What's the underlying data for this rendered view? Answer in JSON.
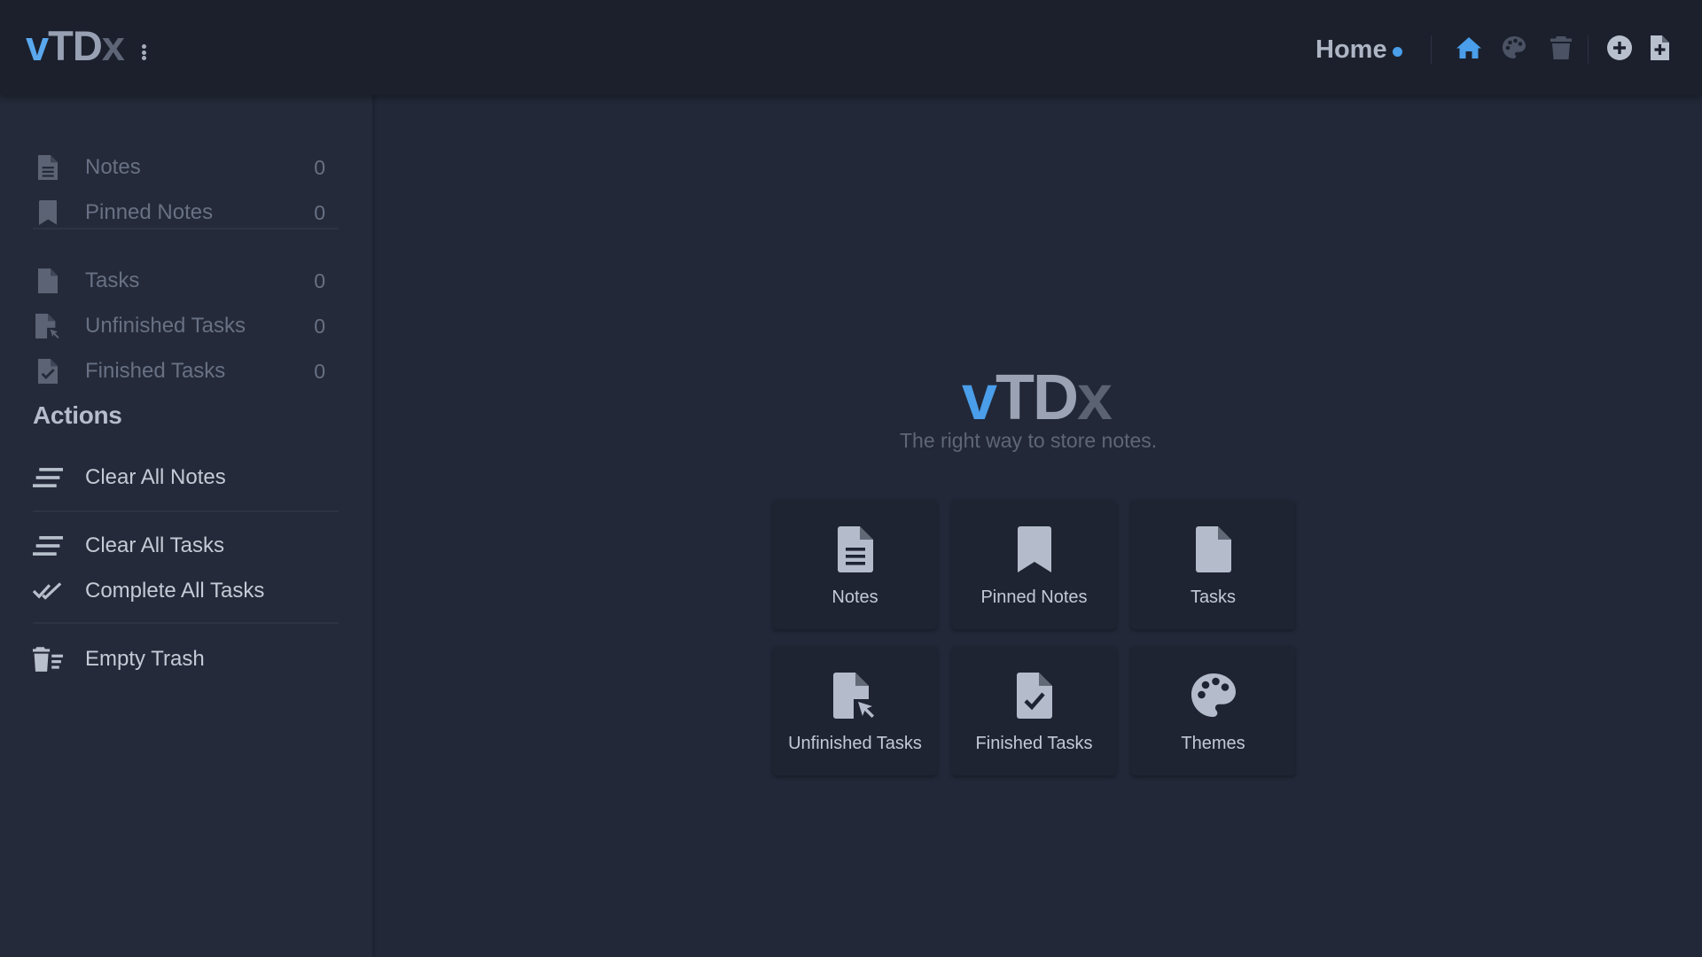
{
  "app": {
    "logo": {
      "v": "v",
      "td": "TD",
      "x": "x"
    },
    "nav_title": "Home"
  },
  "header_icons": [
    "home-icon",
    "palette-icon",
    "trash-icon",
    "plus-circle-icon",
    "add-file-icon"
  ],
  "sidebar": {
    "notes_group": [
      {
        "label": "Notes",
        "count": "0",
        "icon": "file-text-icon"
      },
      {
        "label": "Pinned Notes",
        "count": "0",
        "icon": "bookmark-icon"
      }
    ],
    "tasks_group": [
      {
        "label": "Tasks",
        "count": "0",
        "icon": "file-icon"
      },
      {
        "label": "Unfinished Tasks",
        "count": "0",
        "icon": "file-cursor-icon"
      },
      {
        "label": "Finished Tasks",
        "count": "0",
        "icon": "file-check-icon"
      }
    ],
    "actions_title": "Actions",
    "actions": {
      "clear_notes": "Clear All Notes",
      "clear_tasks": "Clear All Tasks",
      "complete_tasks": "Complete All Tasks",
      "empty_trash": "Empty Trash"
    }
  },
  "main": {
    "hero": {
      "v": "v",
      "td": "TD",
      "x": "x"
    },
    "tagline": "The right way to store notes.",
    "cards": [
      {
        "label": "Notes",
        "icon": "file-text-icon"
      },
      {
        "label": "Pinned Notes",
        "icon": "bookmark-icon"
      },
      {
        "label": "Tasks",
        "icon": "file-icon"
      },
      {
        "label": "Unfinished Tasks",
        "icon": "file-cursor-icon"
      },
      {
        "label": "Finished Tasks",
        "icon": "file-check-icon"
      },
      {
        "label": "Themes",
        "icon": "palette-icon"
      }
    ]
  },
  "colors": {
    "accent": "#4a9eea",
    "background": "#222838",
    "header": "#1b202c",
    "card": "#1f2432"
  }
}
